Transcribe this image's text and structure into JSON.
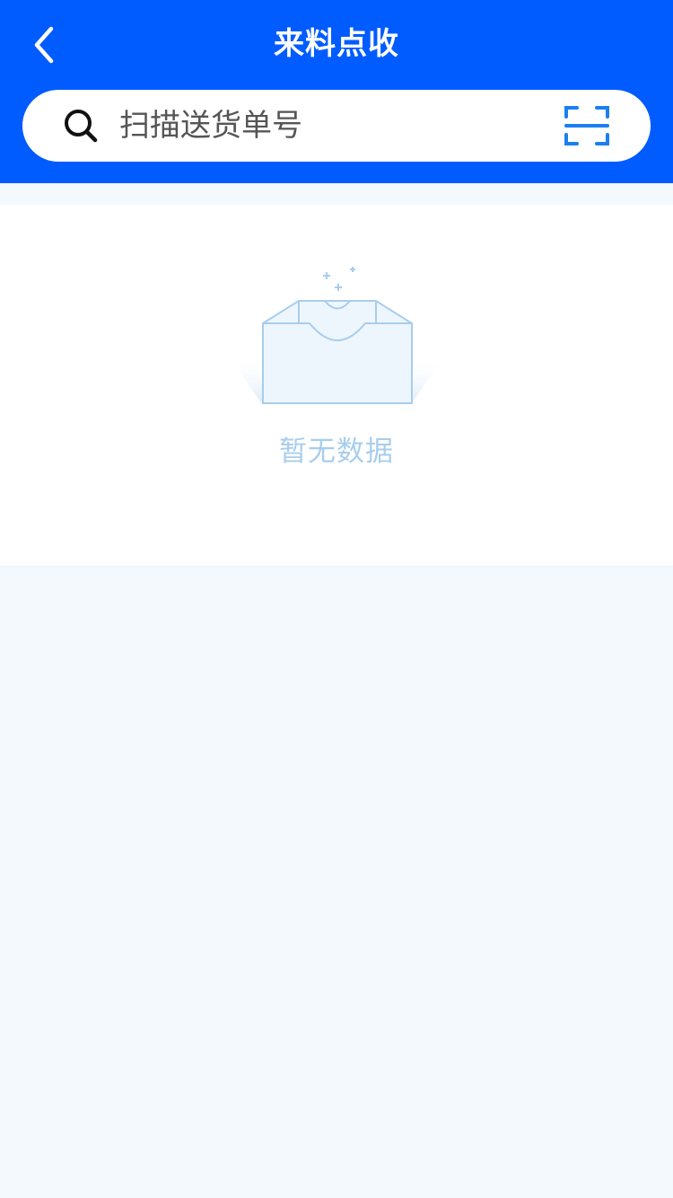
{
  "header": {
    "title": "来料点收",
    "back_icon": "chevron-left-icon",
    "background_color": "#005cff"
  },
  "search": {
    "placeholder": "扫描送货单号",
    "value": "",
    "search_icon": "search-icon",
    "scan_icon": "scan-icon"
  },
  "empty_state": {
    "icon": "empty-box-icon",
    "text": "暂无数据",
    "text_color": "#a8cdec"
  },
  "colors": {
    "primary": "#005cff",
    "scan_icon": "#1a7ff0",
    "page_background": "#f4f9fe"
  }
}
